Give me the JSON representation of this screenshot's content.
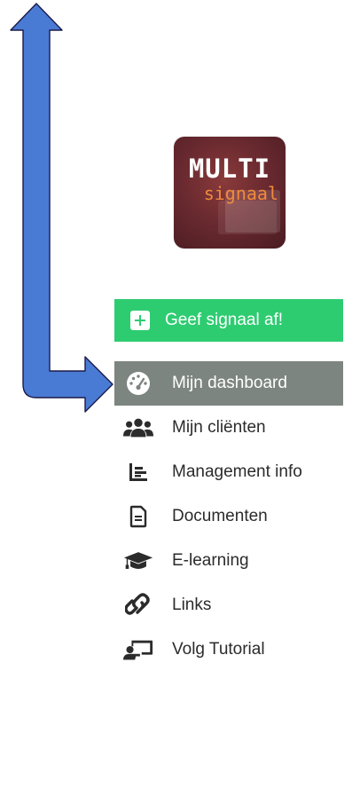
{
  "logo": {
    "title": "MULTI",
    "subtitle": "signaal"
  },
  "cta": {
    "label": "Geef signaal af!",
    "icon": "plus-square-icon",
    "color": "#2ecc71"
  },
  "menu": {
    "items": [
      {
        "label": "Mijn dashboard",
        "icon": "dashboard-gauge-icon",
        "active": true
      },
      {
        "label": "Mijn cliënten",
        "icon": "users-icon"
      },
      {
        "label": "Management info",
        "icon": "bar-chart-icon"
      },
      {
        "label": "Documenten",
        "icon": "document-icon"
      },
      {
        "label": "E-learning",
        "icon": "graduation-cap-icon"
      },
      {
        "label": "Links",
        "icon": "link-icon"
      },
      {
        "label": "Volg Tutorial",
        "icon": "presentation-icon"
      }
    ],
    "active_color": "#7d8580"
  },
  "annotation": {
    "icon": "blue-arrow-icon",
    "color": "#4a7bd4"
  }
}
